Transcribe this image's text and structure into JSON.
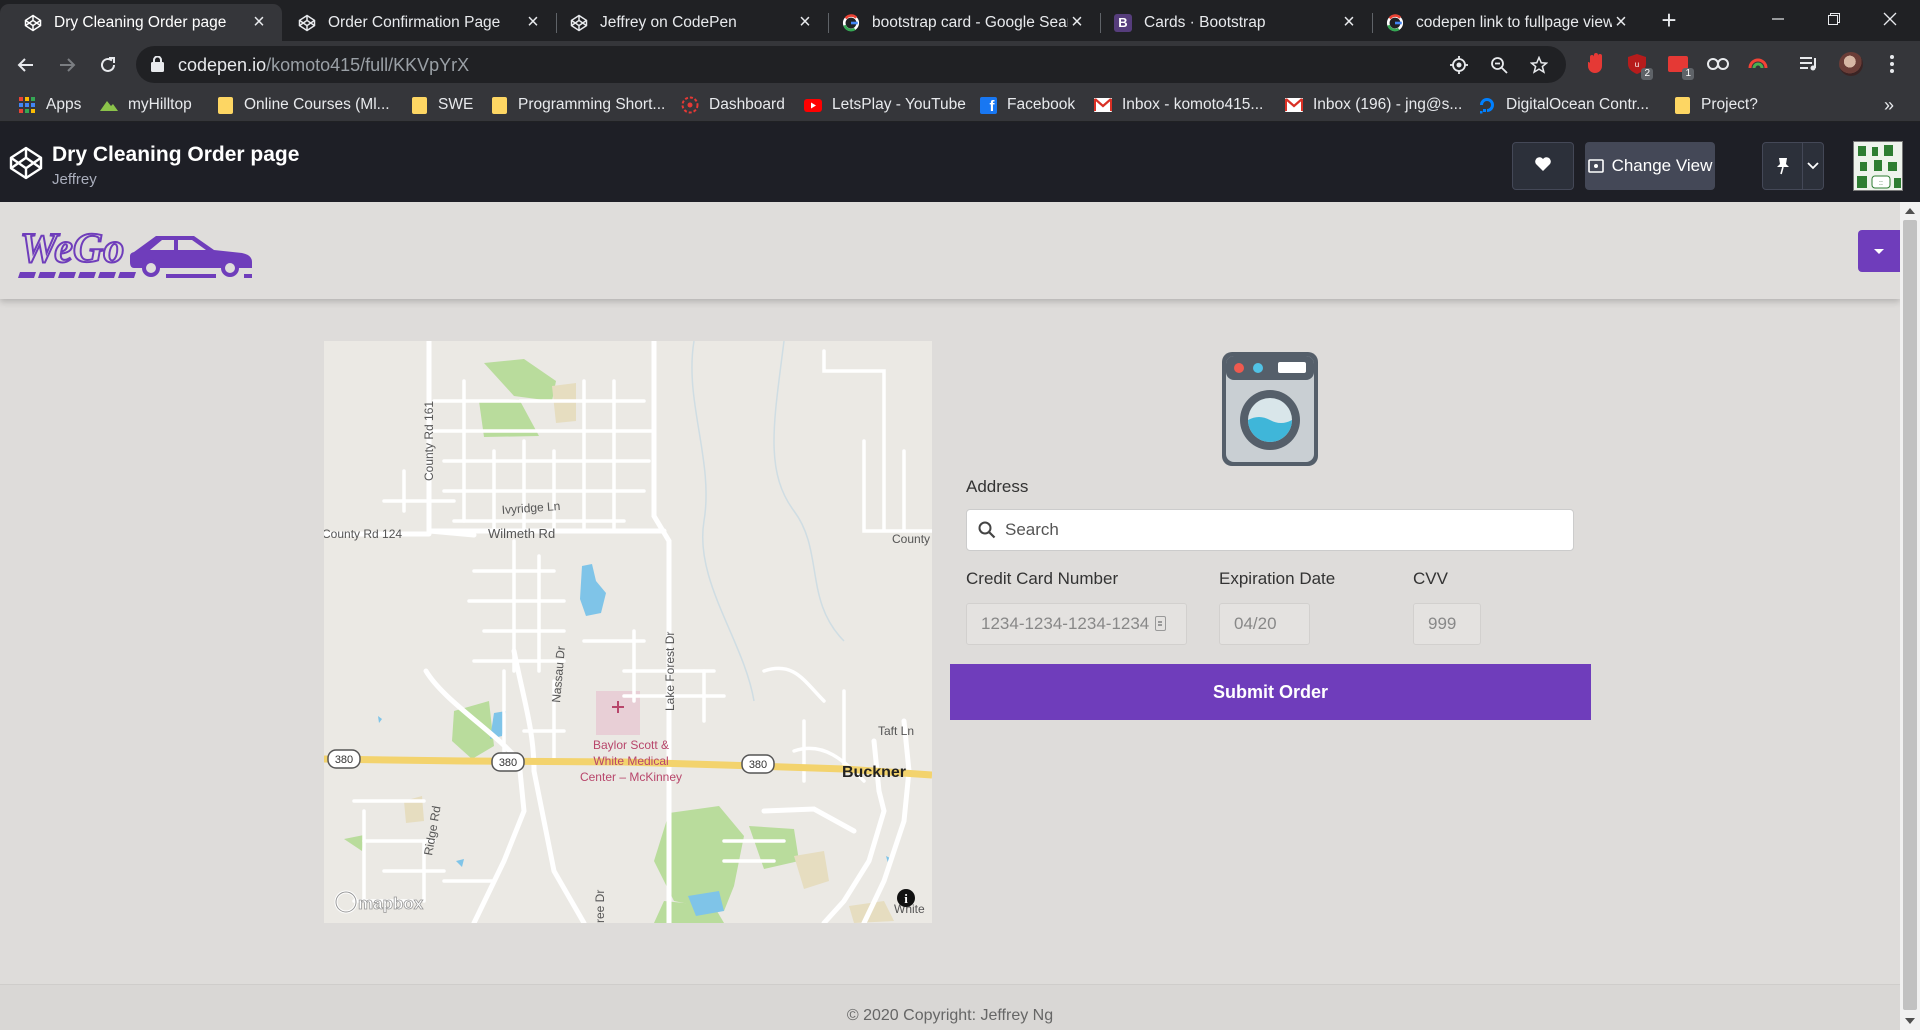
{
  "browser": {
    "tabs": [
      {
        "title": "Dry Cleaning Order page",
        "icon": "codepen-icon",
        "active": true
      },
      {
        "title": "Order Confirmation Page",
        "icon": "codepen-icon",
        "active": false
      },
      {
        "title": "Jeffrey on CodePen",
        "icon": "codepen-icon",
        "active": false
      },
      {
        "title": "bootstrap card - Google Sear",
        "icon": "google-icon",
        "active": false
      },
      {
        "title": "Cards · Bootstrap",
        "icon": "bootstrap-icon",
        "active": false
      },
      {
        "title": "codepen link to fullpage view",
        "icon": "google-icon",
        "active": false
      }
    ],
    "url_host": "codepen.io",
    "url_path": "/komoto415/full/KKVpYrX",
    "extension_badges": {
      "ublock": "2",
      "ext2": "1"
    }
  },
  "bookmarks": [
    {
      "label": "Apps",
      "icon": "apps-grid-icon"
    },
    {
      "label": "myHilltop",
      "icon": "hilltop-icon"
    },
    {
      "label": "Online Courses (Ml...",
      "icon": "folder-icon"
    },
    {
      "label": "SWE",
      "icon": "folder-icon"
    },
    {
      "label": "Programming Short...",
      "icon": "folder-icon"
    },
    {
      "label": "Dashboard",
      "icon": "dashboard-icon"
    },
    {
      "label": "LetsPlay - YouTube",
      "icon": "youtube-icon"
    },
    {
      "label": "Facebook",
      "icon": "facebook-icon"
    },
    {
      "label": "Inbox - komoto415...",
      "icon": "gmail-icon"
    },
    {
      "label": "Inbox (196) - jng@s...",
      "icon": "gmail-icon"
    },
    {
      "label": "DigitalOcean Contr...",
      "icon": "digitalocean-icon"
    },
    {
      "label": "Project?",
      "icon": "folder-icon"
    }
  ],
  "codepen": {
    "title": "Dry Cleaning Order page",
    "author": "Jeffrey",
    "change_view": "Change View"
  },
  "site": {
    "brand": "WeGo",
    "brand_color": "#6f3dbb",
    "address_label": "Address",
    "search_placeholder": "Search",
    "card_label": "Credit Card Number",
    "card_value": "1234-1234-1234-1234",
    "exp_label": "Expiration Date",
    "exp_value": "04/20",
    "cvv_label": "CVV",
    "cvv_value": "999",
    "submit_label": "Submit Order",
    "footer": "© 2020 Copyright: Jeffrey Ng"
  },
  "map": {
    "labels": {
      "county_rd_161": "County Rd 161",
      "ivyridge": "Ivyridge Ln",
      "county_rd_124": "County Rd 124",
      "wilmeth": "Wilmeth Rd",
      "county_right": "County",
      "nassau": "Nassau Dr",
      "lake_forest": "Lake Forest Dr",
      "taft": "Taft Ln",
      "buckner": "Buckner",
      "hospital_1": "Baylor Scott &",
      "hospital_2": "White Medical",
      "hospital_3": "Center – McKinney",
      "ridge": "Ridge Rd",
      "ree": "ree Dr",
      "white": "White",
      "shield": "380",
      "attribution": "mapbox"
    }
  }
}
